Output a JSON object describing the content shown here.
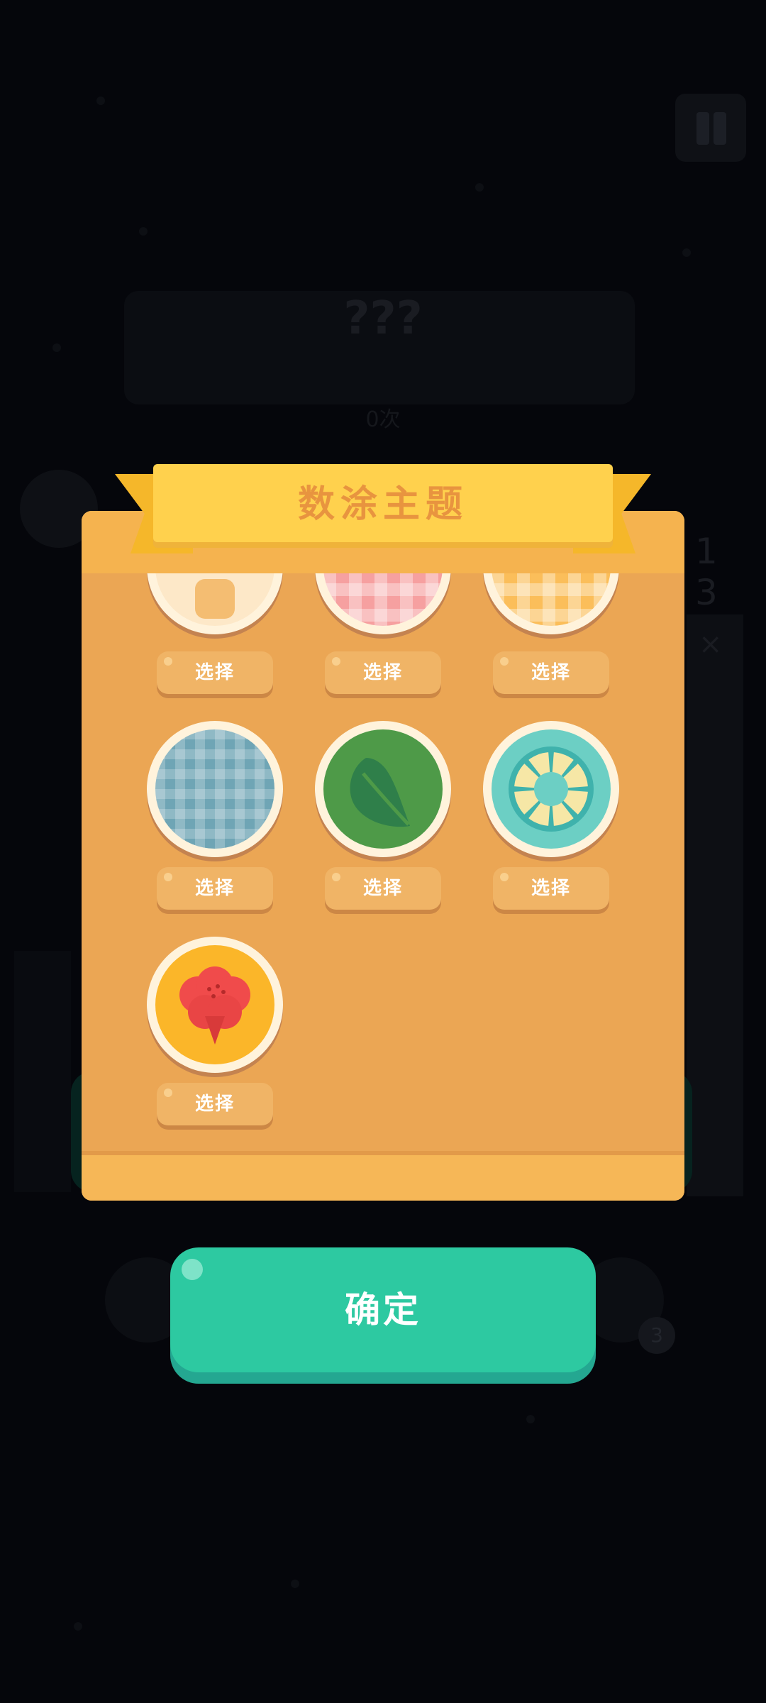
{
  "background": {
    "level_title": "???",
    "attempts_text": "0次",
    "side_numbers": [
      "1",
      "3"
    ],
    "close_glyph": "×",
    "badge_count": "3"
  },
  "dialog": {
    "title": "数涂主题",
    "themes": [
      {
        "pattern": "cream-orange-motif",
        "select_label": "选择"
      },
      {
        "pattern": "pink-gingham",
        "select_label": "选择"
      },
      {
        "pattern": "yellow-gingham",
        "select_label": "选择"
      },
      {
        "pattern": "blue-plaid",
        "select_label": "选择"
      },
      {
        "pattern": "green-leaf",
        "select_label": "选择"
      },
      {
        "pattern": "teal-sun",
        "select_label": "选择"
      },
      {
        "pattern": "red-flower",
        "select_label": "选择"
      }
    ],
    "confirm_label": "确定"
  },
  "colors": {
    "dialog_bg": "#eba654",
    "ribbon": "#ffd14d",
    "ribbon_text": "#e8943f",
    "confirm": "#2dc9a1"
  }
}
